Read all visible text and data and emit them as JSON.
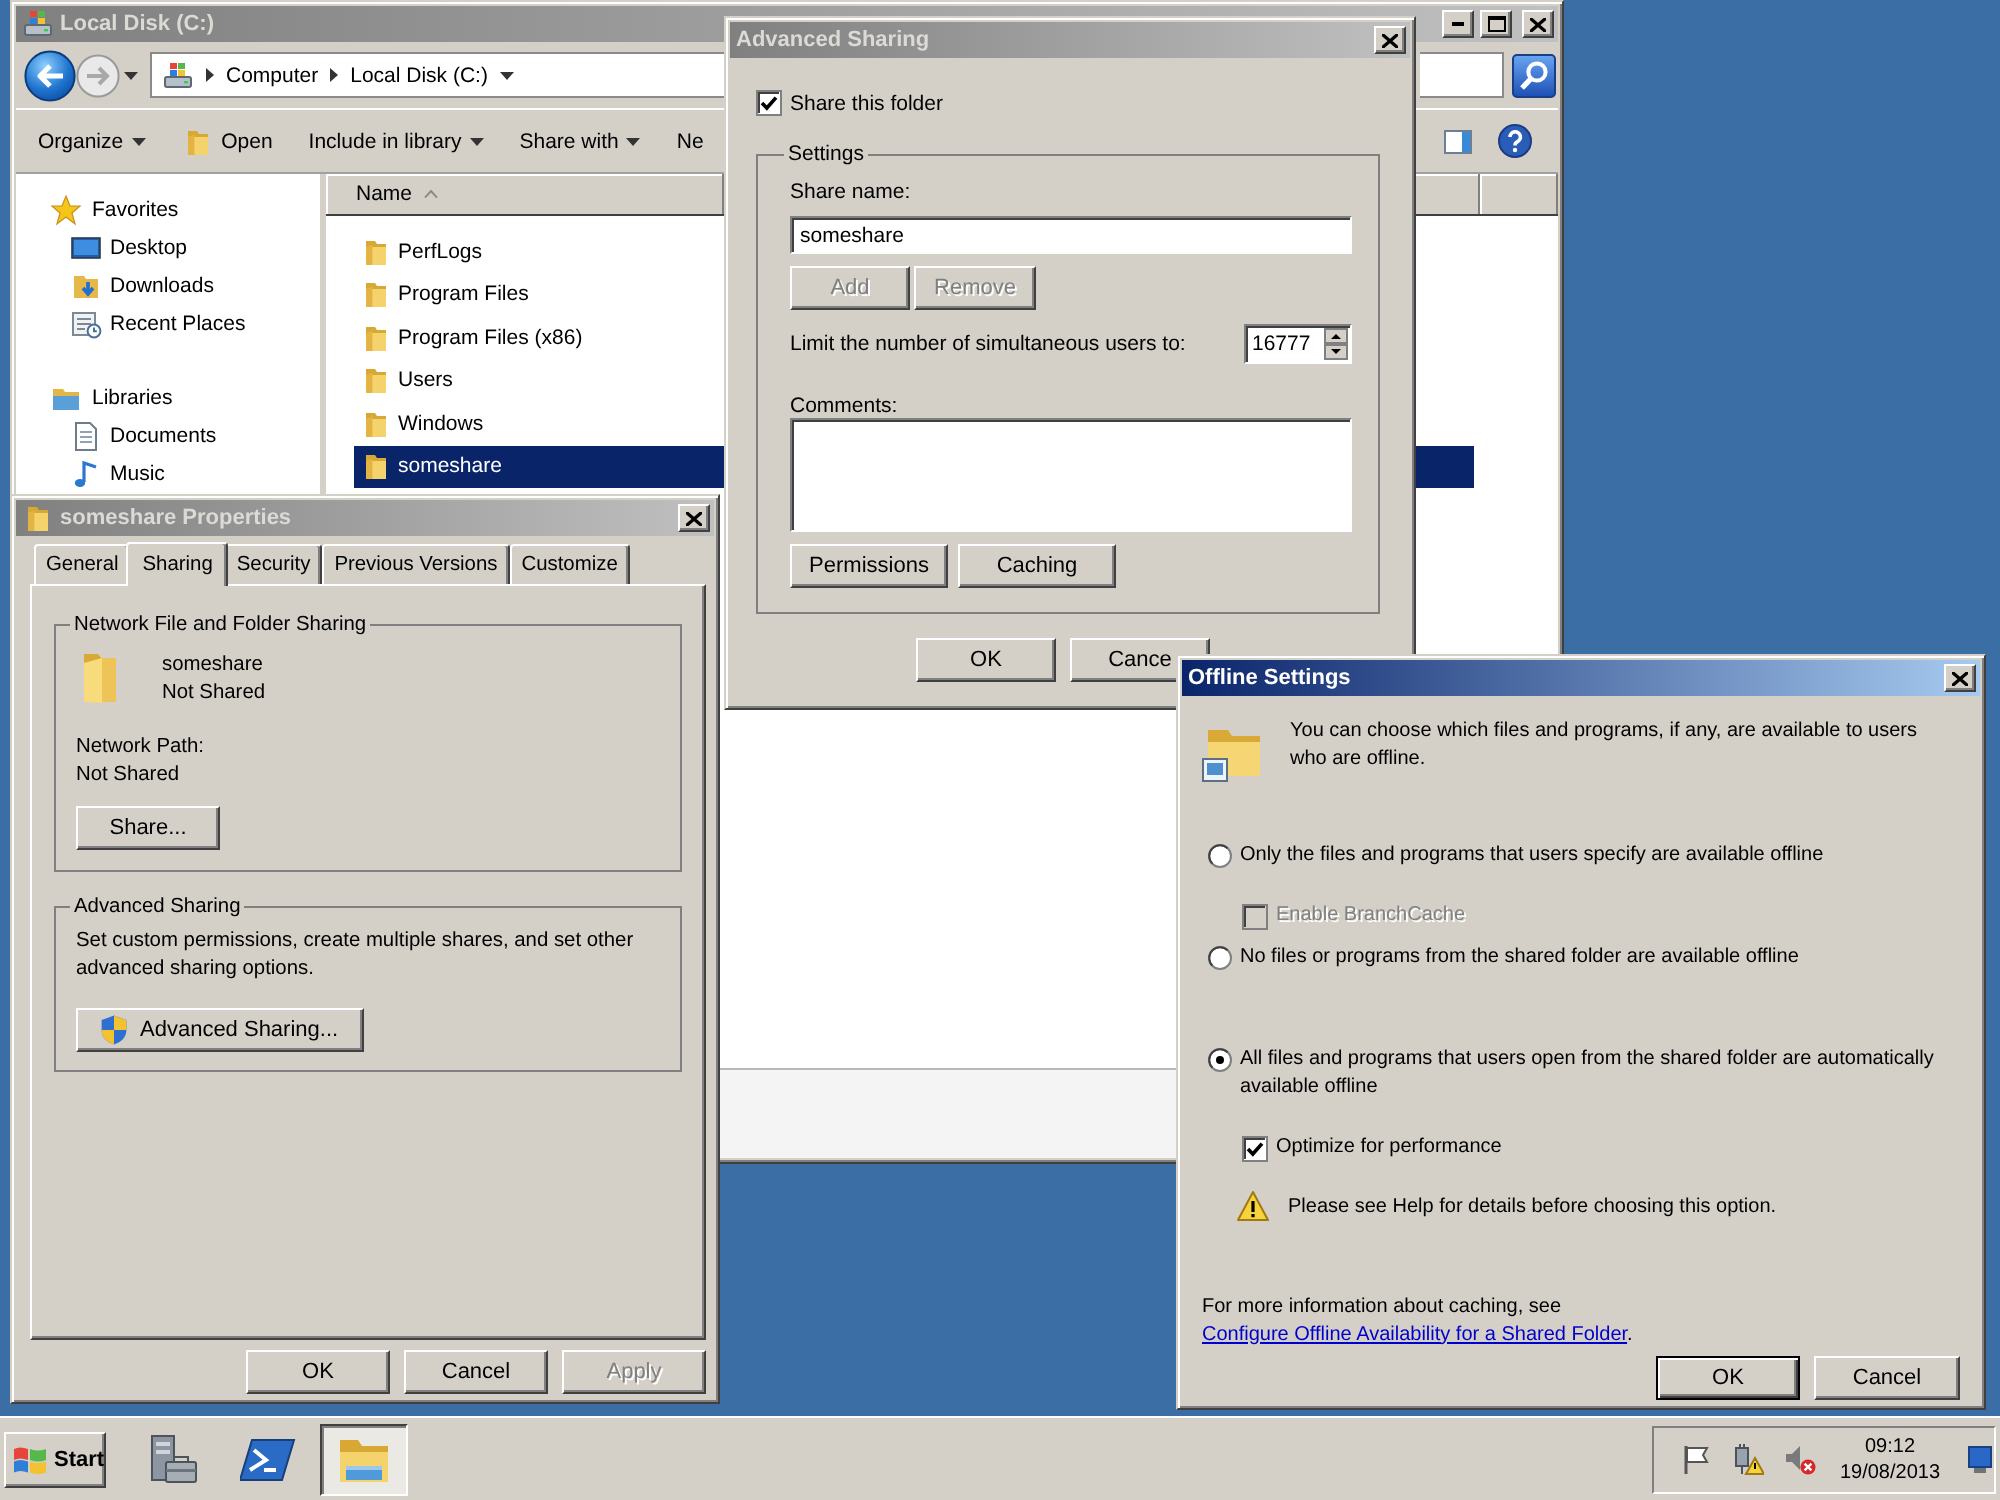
{
  "explorer": {
    "active": false,
    "title": "Local Disk (C:)",
    "breadcrumb": [
      "Computer",
      "Local Disk (C:)"
    ],
    "toolbar": [
      {
        "kind": "menu",
        "label": "Organize"
      },
      {
        "kind": "open",
        "label": "Open"
      },
      {
        "kind": "menu",
        "label": "Include in library"
      },
      {
        "kind": "menu",
        "label": "Share with"
      },
      {
        "kind": "plain",
        "label": "Ne"
      }
    ],
    "navigation": [
      {
        "kind": "favorites",
        "label": "Favorites",
        "children": [
          {
            "kind": "desktop",
            "label": "Desktop"
          },
          {
            "kind": "downloads",
            "label": "Downloads"
          },
          {
            "kind": "recent",
            "label": "Recent Places"
          }
        ]
      },
      {
        "kind": "libraries",
        "label": "Libraries",
        "children": [
          {
            "kind": "documents",
            "label": "Documents"
          },
          {
            "kind": "music",
            "label": "Music"
          }
        ]
      }
    ],
    "columns": [
      {
        "label": "Name",
        "sorted": true
      }
    ],
    "files": [
      {
        "name": "PerfLogs",
        "selected": false
      },
      {
        "name": "Program Files",
        "selected": false
      },
      {
        "name": "Program Files (x86)",
        "selected": false
      },
      {
        "name": "Users",
        "selected": false
      },
      {
        "name": "Windows",
        "selected": false
      },
      {
        "name": "someshare",
        "selected": true
      }
    ]
  },
  "properties": {
    "active": false,
    "title": "someshare Properties",
    "tabs": [
      {
        "label": "General",
        "selected": false
      },
      {
        "label": "Sharing",
        "selected": true
      },
      {
        "label": "Security",
        "selected": false
      },
      {
        "label": "Previous Versions",
        "selected": false
      },
      {
        "label": "Customize",
        "selected": false
      }
    ],
    "network_sharing": {
      "heading": "Network File and Folder Sharing",
      "folder_name": "someshare",
      "folder_status": "Not Shared",
      "path_label": "Network Path:",
      "path": "Not Shared",
      "button": "Share..."
    },
    "advanced_sharing": {
      "heading": "Advanced Sharing",
      "description": "Set custom permissions, create multiple shares, and set other advanced sharing options.",
      "button": "Advanced Sharing..."
    },
    "buttons": [
      {
        "label": "OK",
        "disabled": false
      },
      {
        "label": "Cancel",
        "disabled": false
      },
      {
        "label": "Apply",
        "disabled": true
      }
    ]
  },
  "advanced_sharing": {
    "active": false,
    "title": "Advanced Sharing",
    "share_folder": {
      "label": "Share this folder",
      "checked": true
    },
    "settings": {
      "heading": "Settings",
      "share_name_label": "Share name:",
      "share_name": "someshare",
      "name_buttons": [
        {
          "label": "Add",
          "disabled": true
        },
        {
          "label": "Remove",
          "disabled": true
        }
      ],
      "user_limit_label": "Limit the number of simultaneous users to:",
      "user_limit": "16777",
      "comments_label": "Comments:",
      "buttons": [
        {
          "label": "Permissions",
          "disabled": false
        },
        {
          "label": "Caching",
          "disabled": false
        }
      ]
    },
    "buttons": [
      {
        "label": "OK",
        "disabled": false
      },
      {
        "label": "Cance",
        "disabled": false
      }
    ]
  },
  "offline_settings": {
    "active": true,
    "title": "Offline Settings",
    "intro": "You can choose which files and programs, if any, are available to users who are offline.",
    "choices": [
      {
        "label": "Only the files and programs that users specify are available offline",
        "selected": false,
        "options": [
          {
            "kind": "checkbox",
            "label": "Enable BranchCache",
            "checked": false,
            "disabled": true
          }
        ]
      },
      {
        "label": "No files or programs from the shared folder are available offline",
        "selected": false
      },
      {
        "label": "All files and programs that users open from the shared folder are automatically available offline",
        "selected": true,
        "options": [
          {
            "kind": "checkbox",
            "label": "Optimize for performance",
            "checked": true,
            "disabled": false
          },
          {
            "kind": "warning",
            "label": "Please see Help for details before choosing this option."
          }
        ]
      }
    ],
    "footer": {
      "text": "For more information about caching, see",
      "link": "Configure Offline Availability for a Shared Folder",
      "after": "."
    },
    "buttons": [
      {
        "label": "OK",
        "default": true
      },
      {
        "label": "Cancel",
        "default": false
      }
    ]
  },
  "taskbar": {
    "start": "Start",
    "apps": [
      {
        "kind": "server-manager",
        "active": false
      },
      {
        "kind": "powershell",
        "active": false
      },
      {
        "kind": "explorer",
        "active": true
      }
    ],
    "clock": {
      "time": "09:12",
      "date": "19/08/2013"
    }
  }
}
